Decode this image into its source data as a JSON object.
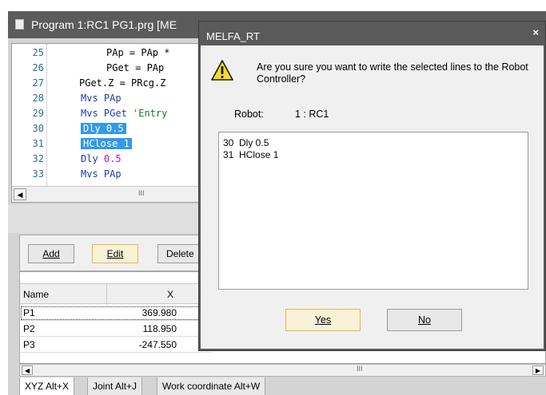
{
  "editor": {
    "title": "Program 1:RC1 PG1.prg   [ME",
    "lines": [
      {
        "num": "25",
        "segments": [
          {
            "text": "PAp = PAp * ",
            "cls": ""
          }
        ],
        "indent": "indent2"
      },
      {
        "num": "26",
        "segments": [
          {
            "text": "PGet = PAp",
            "cls": ""
          }
        ],
        "indent": "indent2"
      },
      {
        "num": "27",
        "segments": [
          {
            "text": "PGet.Z = PRcg.Z",
            "cls": ""
          }
        ],
        "indent": "indent1"
      },
      {
        "num": "28",
        "segments": [
          {
            "text": "Mvs PAp",
            "cls": "kw"
          }
        ],
        "indent": "indent0"
      },
      {
        "num": "29",
        "segments": [
          {
            "text": "Mvs PGet ",
            "cls": "kw"
          },
          {
            "text": "'Entry",
            "cls": "str"
          }
        ],
        "indent": "indent0"
      },
      {
        "num": "30",
        "segments": [
          {
            "text": "Dly 0.5",
            "cls": "sel"
          }
        ],
        "indent": "indent0"
      },
      {
        "num": "31",
        "segments": [
          {
            "text": "HClose 1",
            "cls": "sel"
          }
        ],
        "indent": "indent0"
      },
      {
        "num": "32",
        "segments": [
          {
            "text": "Dly ",
            "cls": "kw"
          },
          {
            "text": "0.5",
            "cls": "num"
          }
        ],
        "indent": "indent0"
      },
      {
        "num": "33",
        "segments": [
          {
            "text": "Mvs PAp",
            "cls": "kw"
          }
        ],
        "indent": "indent0"
      }
    ],
    "scroll_grip": "III"
  },
  "buttons": {
    "add": "Add",
    "edit": "Edit",
    "delete": "Delete"
  },
  "table": {
    "columns": [
      "Name",
      "X"
    ],
    "rows": [
      {
        "name": "P1",
        "x": "369.980"
      },
      {
        "name": "P2",
        "x": "118.950"
      },
      {
        "name": "P3",
        "x": "-247.550"
      }
    ],
    "scroll_grip": "III"
  },
  "tabs": [
    {
      "label": "XYZ  Alt+X",
      "active": true
    },
    {
      "label": "Joint  Alt+J",
      "active": false
    },
    {
      "label": "Work coordinate   Alt+W",
      "active": false
    }
  ],
  "dialog": {
    "title": "MELFA_RT",
    "close": "×",
    "message": "Are you sure you want to write the selected lines to the Robot Controller?",
    "robot_label": "Robot:",
    "robot_value": "1 : RC1",
    "selected_lines": [
      "30  Dly 0.5",
      "31  HClose 1"
    ],
    "yes": "Yes",
    "no": "No",
    "warning_icon": "warning-icon"
  },
  "colors": {
    "selection": "#3399e8",
    "titlebar": "#5b5b5b",
    "focus_border": "#e5b74a",
    "keyword": "#1c3fa8",
    "number": "#c80fb4"
  }
}
